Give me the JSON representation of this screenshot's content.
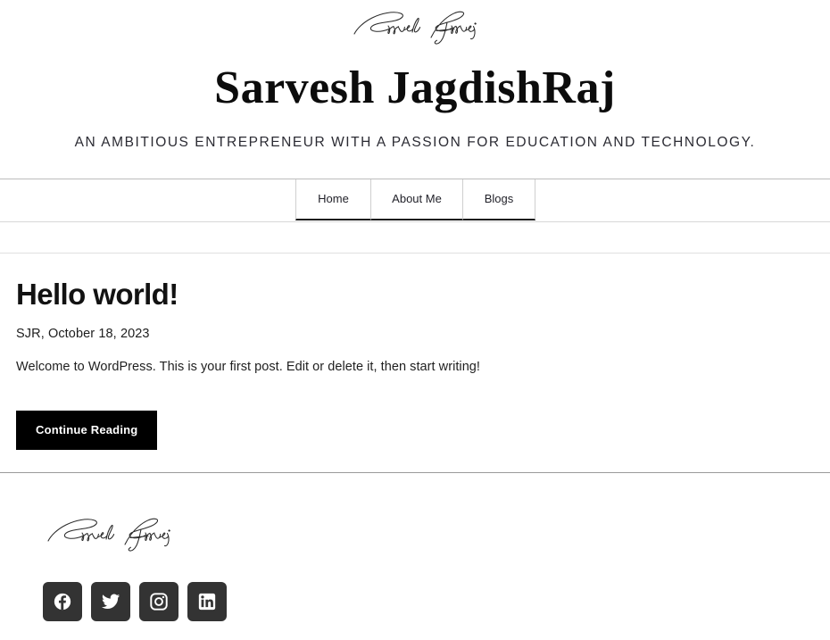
{
  "header": {
    "logo_alt": "Sarvesh JagdishRaj signature logo",
    "title": "Sarvesh JagdishRaj",
    "tagline": "AN AMBITIOUS ENTREPRENEUR WITH A PASSION FOR EDUCATION AND TECHNOLOGY."
  },
  "nav": {
    "items": [
      {
        "label": "Home"
      },
      {
        "label": "About Me"
      },
      {
        "label": "Blogs"
      }
    ]
  },
  "post": {
    "title": "Hello world!",
    "meta": "SJR, October 18, 2023",
    "excerpt": "Welcome to WordPress. This is your first post. Edit or delete it, then start writing!",
    "button_label": "Continue Reading"
  },
  "footer": {
    "logo_alt": "Sarvesh JagdishRaj signature logo",
    "social": [
      {
        "name": "facebook-icon",
        "label": "Facebook"
      },
      {
        "name": "twitter-icon",
        "label": "Twitter"
      },
      {
        "name": "instagram-icon",
        "label": "Instagram"
      },
      {
        "name": "linkedin-icon",
        "label": "LinkedIn"
      }
    ]
  },
  "colors": {
    "text": "#1a1a1a",
    "button_bg": "#000000",
    "button_text": "#ffffff",
    "social_bg": "#333333",
    "rule": "#e0e0e0"
  }
}
